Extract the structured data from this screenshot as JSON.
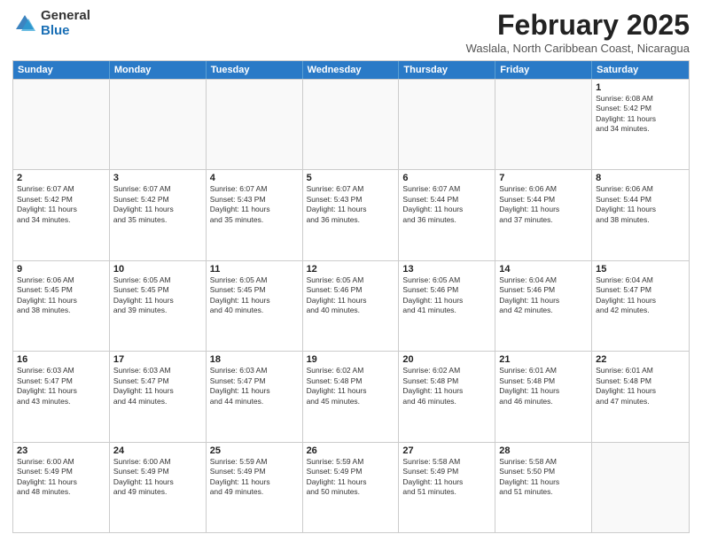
{
  "header": {
    "logo_general": "General",
    "logo_blue": "Blue",
    "title": "February 2025",
    "location": "Waslala, North Caribbean Coast, Nicaragua"
  },
  "calendar": {
    "weekdays": [
      "Sunday",
      "Monday",
      "Tuesday",
      "Wednesday",
      "Thursday",
      "Friday",
      "Saturday"
    ],
    "rows": [
      [
        {
          "day": "",
          "info": ""
        },
        {
          "day": "",
          "info": ""
        },
        {
          "day": "",
          "info": ""
        },
        {
          "day": "",
          "info": ""
        },
        {
          "day": "",
          "info": ""
        },
        {
          "day": "",
          "info": ""
        },
        {
          "day": "1",
          "info": "Sunrise: 6:08 AM\nSunset: 5:42 PM\nDaylight: 11 hours\nand 34 minutes."
        }
      ],
      [
        {
          "day": "2",
          "info": "Sunrise: 6:07 AM\nSunset: 5:42 PM\nDaylight: 11 hours\nand 34 minutes."
        },
        {
          "day": "3",
          "info": "Sunrise: 6:07 AM\nSunset: 5:42 PM\nDaylight: 11 hours\nand 35 minutes."
        },
        {
          "day": "4",
          "info": "Sunrise: 6:07 AM\nSunset: 5:43 PM\nDaylight: 11 hours\nand 35 minutes."
        },
        {
          "day": "5",
          "info": "Sunrise: 6:07 AM\nSunset: 5:43 PM\nDaylight: 11 hours\nand 36 minutes."
        },
        {
          "day": "6",
          "info": "Sunrise: 6:07 AM\nSunset: 5:44 PM\nDaylight: 11 hours\nand 36 minutes."
        },
        {
          "day": "7",
          "info": "Sunrise: 6:06 AM\nSunset: 5:44 PM\nDaylight: 11 hours\nand 37 minutes."
        },
        {
          "day": "8",
          "info": "Sunrise: 6:06 AM\nSunset: 5:44 PM\nDaylight: 11 hours\nand 38 minutes."
        }
      ],
      [
        {
          "day": "9",
          "info": "Sunrise: 6:06 AM\nSunset: 5:45 PM\nDaylight: 11 hours\nand 38 minutes."
        },
        {
          "day": "10",
          "info": "Sunrise: 6:05 AM\nSunset: 5:45 PM\nDaylight: 11 hours\nand 39 minutes."
        },
        {
          "day": "11",
          "info": "Sunrise: 6:05 AM\nSunset: 5:45 PM\nDaylight: 11 hours\nand 40 minutes."
        },
        {
          "day": "12",
          "info": "Sunrise: 6:05 AM\nSunset: 5:46 PM\nDaylight: 11 hours\nand 40 minutes."
        },
        {
          "day": "13",
          "info": "Sunrise: 6:05 AM\nSunset: 5:46 PM\nDaylight: 11 hours\nand 41 minutes."
        },
        {
          "day": "14",
          "info": "Sunrise: 6:04 AM\nSunset: 5:46 PM\nDaylight: 11 hours\nand 42 minutes."
        },
        {
          "day": "15",
          "info": "Sunrise: 6:04 AM\nSunset: 5:47 PM\nDaylight: 11 hours\nand 42 minutes."
        }
      ],
      [
        {
          "day": "16",
          "info": "Sunrise: 6:03 AM\nSunset: 5:47 PM\nDaylight: 11 hours\nand 43 minutes."
        },
        {
          "day": "17",
          "info": "Sunrise: 6:03 AM\nSunset: 5:47 PM\nDaylight: 11 hours\nand 44 minutes."
        },
        {
          "day": "18",
          "info": "Sunrise: 6:03 AM\nSunset: 5:47 PM\nDaylight: 11 hours\nand 44 minutes."
        },
        {
          "day": "19",
          "info": "Sunrise: 6:02 AM\nSunset: 5:48 PM\nDaylight: 11 hours\nand 45 minutes."
        },
        {
          "day": "20",
          "info": "Sunrise: 6:02 AM\nSunset: 5:48 PM\nDaylight: 11 hours\nand 46 minutes."
        },
        {
          "day": "21",
          "info": "Sunrise: 6:01 AM\nSunset: 5:48 PM\nDaylight: 11 hours\nand 46 minutes."
        },
        {
          "day": "22",
          "info": "Sunrise: 6:01 AM\nSunset: 5:48 PM\nDaylight: 11 hours\nand 47 minutes."
        }
      ],
      [
        {
          "day": "23",
          "info": "Sunrise: 6:00 AM\nSunset: 5:49 PM\nDaylight: 11 hours\nand 48 minutes."
        },
        {
          "day": "24",
          "info": "Sunrise: 6:00 AM\nSunset: 5:49 PM\nDaylight: 11 hours\nand 49 minutes."
        },
        {
          "day": "25",
          "info": "Sunrise: 5:59 AM\nSunset: 5:49 PM\nDaylight: 11 hours\nand 49 minutes."
        },
        {
          "day": "26",
          "info": "Sunrise: 5:59 AM\nSunset: 5:49 PM\nDaylight: 11 hours\nand 50 minutes."
        },
        {
          "day": "27",
          "info": "Sunrise: 5:58 AM\nSunset: 5:49 PM\nDaylight: 11 hours\nand 51 minutes."
        },
        {
          "day": "28",
          "info": "Sunrise: 5:58 AM\nSunset: 5:50 PM\nDaylight: 11 hours\nand 51 minutes."
        },
        {
          "day": "",
          "info": ""
        }
      ]
    ]
  }
}
